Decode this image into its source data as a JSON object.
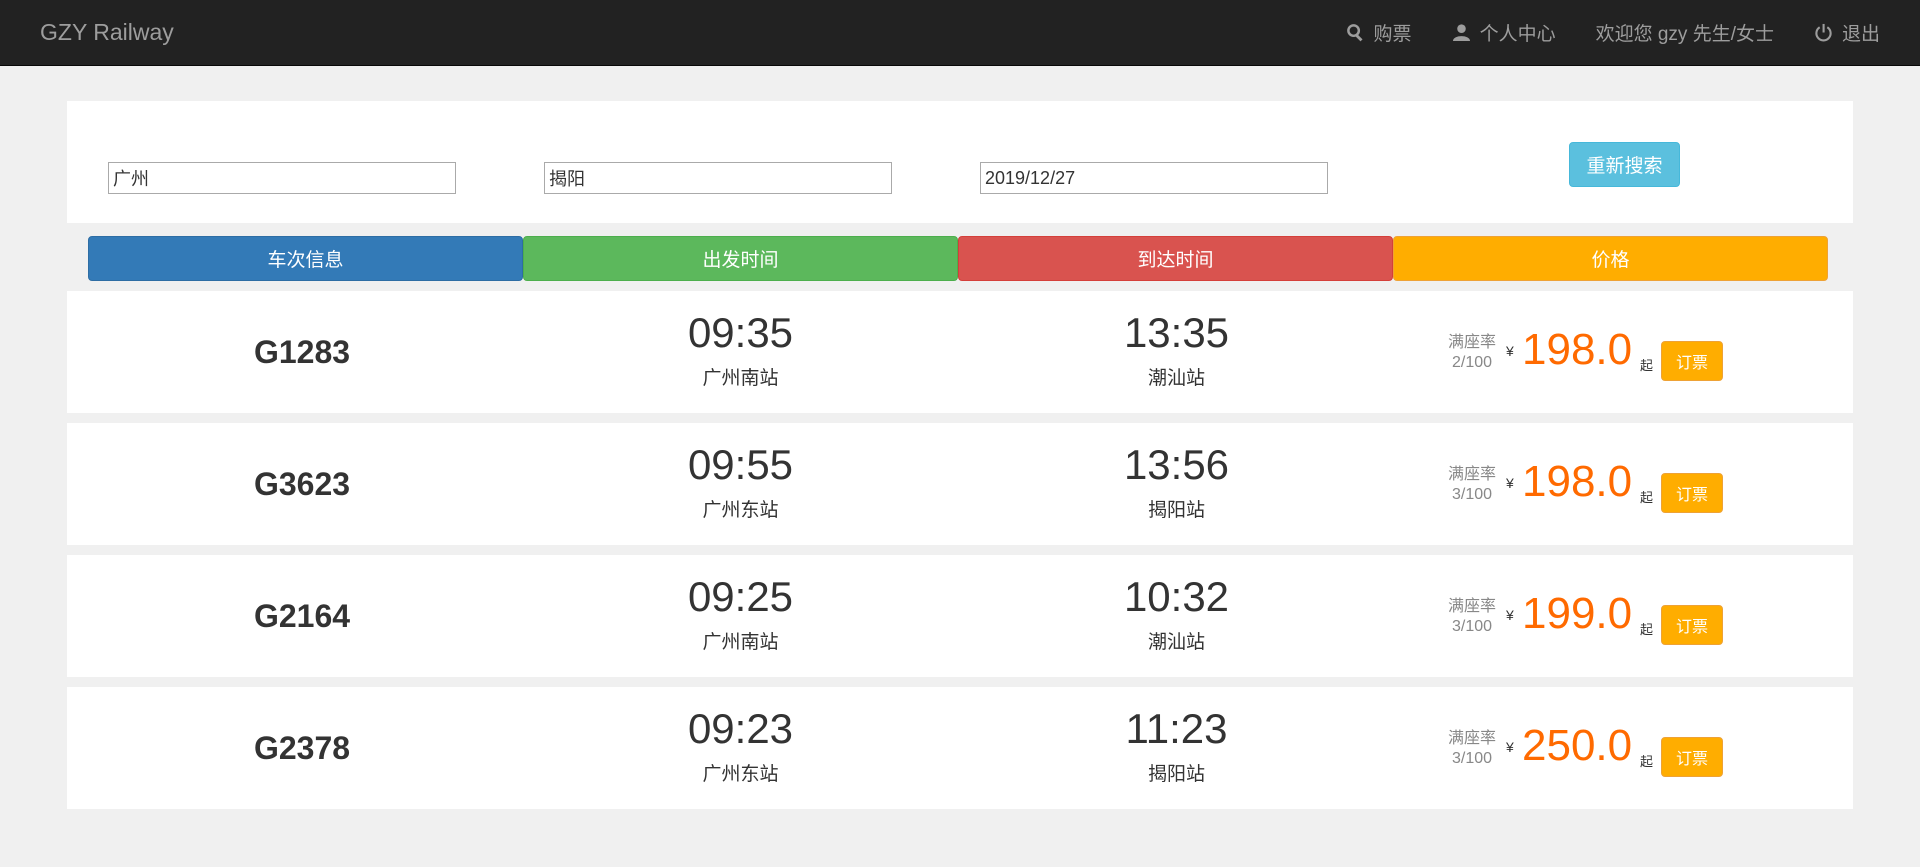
{
  "navbar": {
    "brand": "GZY Railway",
    "buy_label": "购票",
    "profile_label": "个人中心",
    "welcome_text": "欢迎您 gzy 先生/女士",
    "logout_label": "退出"
  },
  "search": {
    "from_value": "广州",
    "to_value": "揭阳",
    "date_value": "2019/12/27",
    "research_label": "重新搜索"
  },
  "table_header": {
    "train_info": "车次信息",
    "depart_time": "出发时间",
    "arrive_time": "到达时间",
    "price": "价格"
  },
  "colors": {
    "train_info": "#337ab7",
    "depart_time": "#5cb85c",
    "arrive_time": "#d9534f",
    "price": "#ffad00",
    "price_text": "#ff6a00"
  },
  "trains": [
    {
      "train_no": "G1283",
      "depart_time": "09:35",
      "depart_station": "广州南站",
      "arrive_time": "13:35",
      "arrive_station": "潮汕站",
      "rate_label": "满座率",
      "rate_value": "2/100",
      "currency": "¥",
      "price": "198.0",
      "price_suffix": "起",
      "book_label": "订票"
    },
    {
      "train_no": "G3623",
      "depart_time": "09:55",
      "depart_station": "广州东站",
      "arrive_time": "13:56",
      "arrive_station": "揭阳站",
      "rate_label": "满座率",
      "rate_value": "3/100",
      "currency": "¥",
      "price": "198.0",
      "price_suffix": "起",
      "book_label": "订票"
    },
    {
      "train_no": "G2164",
      "depart_time": "09:25",
      "depart_station": "广州南站",
      "arrive_time": "10:32",
      "arrive_station": "潮汕站",
      "rate_label": "满座率",
      "rate_value": "3/100",
      "currency": "¥",
      "price": "199.0",
      "price_suffix": "起",
      "book_label": "订票"
    },
    {
      "train_no": "G2378",
      "depart_time": "09:23",
      "depart_station": "广州东站",
      "arrive_time": "11:23",
      "arrive_station": "揭阳站",
      "rate_label": "满座率",
      "rate_value": "3/100",
      "currency": "¥",
      "price": "250.0",
      "price_suffix": "起",
      "book_label": "订票"
    }
  ]
}
